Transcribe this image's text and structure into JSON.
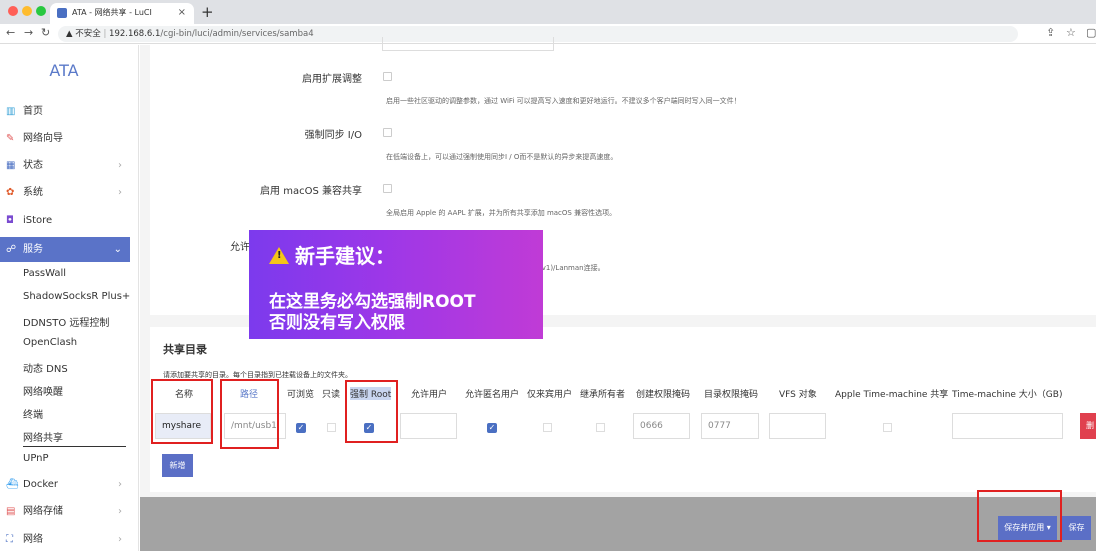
{
  "browser": {
    "tab_title": "ATA - 网络共享 - LuCI",
    "tab_close": "×",
    "new_tab": "+",
    "not_secure": "不安全",
    "url_host": "192.168.6.1",
    "url_path": "/cgi-bin/luci/admin/services/samba4"
  },
  "sidebar": {
    "brand": "ATA",
    "items": [
      {
        "label": "首页",
        "icon": "home-icon"
      },
      {
        "label": "网络向导",
        "icon": "wizard-icon"
      },
      {
        "label": "状态",
        "icon": "status-icon"
      },
      {
        "label": "系统",
        "icon": "system-icon"
      },
      {
        "label": "iStore",
        "icon": "store-icon"
      },
      {
        "label": "服务",
        "icon": "services-icon"
      },
      {
        "label": "Docker",
        "icon": "docker-icon"
      },
      {
        "label": "网络存储",
        "icon": "storage-icon"
      },
      {
        "label": "网络",
        "icon": "network-icon"
      }
    ],
    "sub_items": [
      "PassWall",
      "ShadowSocksR Plus+",
      "DDNSTO 远程控制",
      "OpenClash",
      "动态 DNS",
      "网络唤醒",
      "终端",
      "网络共享",
      "UPnP"
    ]
  },
  "settings": {
    "ext_tune_label": "启用扩展调整",
    "ext_tune_desc": "启用一些社区驱动的调整参数，通过 WiFi 可以提高写入速度和更好地运行。不建议多个客户端同时写入同一文件！",
    "force_sync_label": "强制同步 I/O",
    "force_sync_desc": "在低端设备上，可以通过强制使用同步I / O而不是默认的异步来提高速度。",
    "macos_label": "启用 macOS 兼容共享",
    "macos_desc": "全局启用 Apple 的 AAPL 扩展，并为所有共享添加 macOS 兼容性选项。",
    "allow_label": "允许",
    "allow_desc": "(v1)/Lanman连接。"
  },
  "callout": {
    "title": "新手建议：",
    "line1": "在这里务必勾选强制ROOT",
    "line2": "否则没有写入权限"
  },
  "shares": {
    "section_title": "共享目录",
    "hint": "请添加要共享的目录。每个目录指到已挂载设备上的文件夹。",
    "headers": {
      "name": "名称",
      "path": "路径",
      "browsable": "可浏览",
      "readonly": "只读",
      "force_root": "强制 Root",
      "allow_users": "允许用户",
      "guest": "允许匿名用户",
      "guest_only": "仅来宾用户",
      "inherit": "继承所有者",
      "create_mask": "创建权限掩码",
      "dir_mask": "目录权限掩码",
      "vfs": "VFS 对象",
      "tm": "Apple Time-machine 共享",
      "tm_size": "Time-machine 大小（GB)"
    },
    "row": {
      "name": "myshare",
      "path": "/mnt/usb1",
      "browsable": true,
      "readonly": false,
      "force_root": true,
      "guest": true,
      "guest_only": false,
      "inherit": false,
      "create_mask": "0666",
      "dir_mask": "0777",
      "tm": false
    },
    "add_button": "新增",
    "delete_button": "删"
  },
  "footer": {
    "save_apply": "保存并应用",
    "save": "保存"
  },
  "colors": {
    "accent": "#5a73c8",
    "highlight_box": "#e02020",
    "callout_start": "#7c3aed",
    "callout_end": "#c03bd6"
  }
}
